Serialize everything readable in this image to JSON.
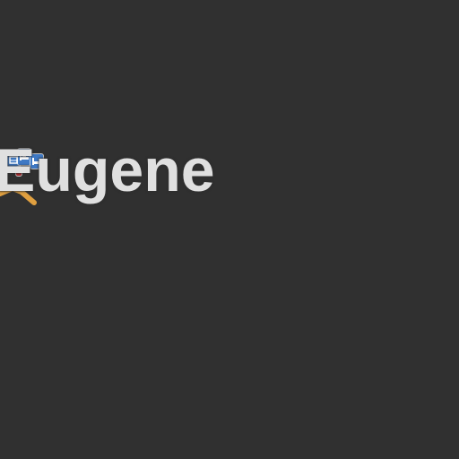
{
  "map": {
    "background_color": "#303030",
    "label_color": "#e0e0e0",
    "road_color": "#e0a040",
    "city_label": "Eugene",
    "poi_icons": [
      {
        "name": "health-icon",
        "color": "#ffffff"
      },
      {
        "name": "transit-icon",
        "color": "#3f79c4"
      },
      {
        "name": "hotel-icon",
        "color": "#3f79c4"
      },
      {
        "name": "lodging-icon",
        "color": "#3f79c4"
      },
      {
        "name": "marker-icon",
        "color": "#b3262b"
      }
    ]
  }
}
